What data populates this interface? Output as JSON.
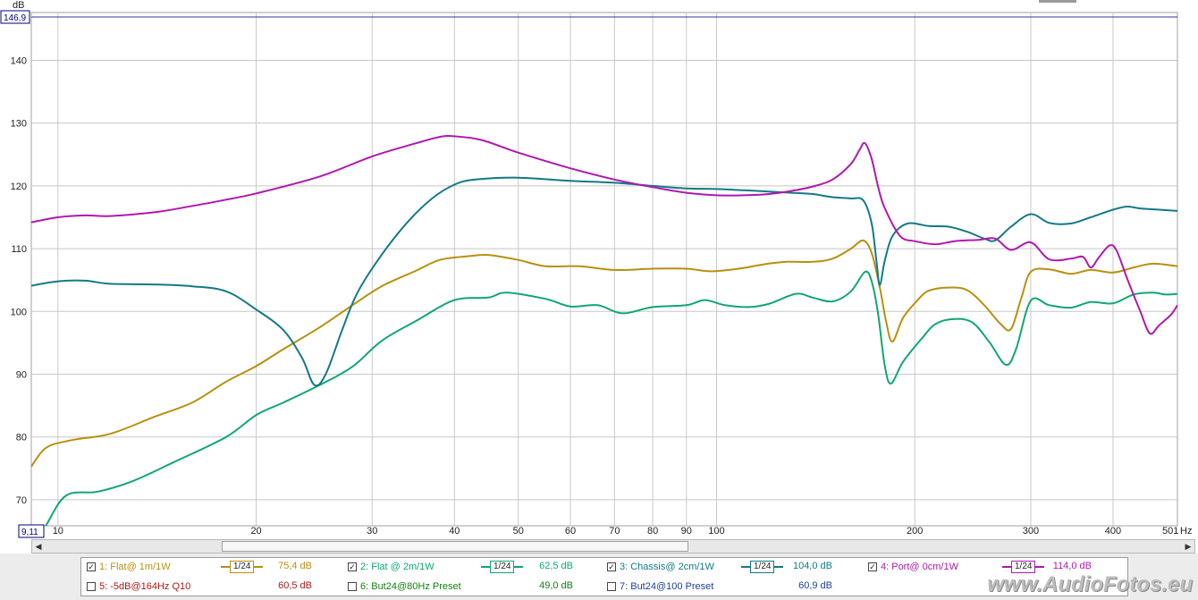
{
  "chart_data": {
    "type": "line",
    "x_scale": "log",
    "xlim": [
      9.11,
      501
    ],
    "ylim": [
      66,
      146.9
    ],
    "y_unit": "dB",
    "x_unit": "Hz",
    "y_top_label": "146,9",
    "x_left_label": "9,11",
    "x_right_label": "501",
    "yticks": [
      70,
      80,
      90,
      100,
      110,
      120,
      130,
      140
    ],
    "xticks": [
      {
        "v": 10,
        "label": "10"
      },
      {
        "v": 20,
        "label": "20"
      },
      {
        "v": 30,
        "label": "30"
      },
      {
        "v": 40,
        "label": "40"
      },
      {
        "v": 50,
        "label": "50"
      },
      {
        "v": 60,
        "label": "60"
      },
      {
        "v": 70,
        "label": "70"
      },
      {
        "v": 80,
        "label": "80"
      },
      {
        "v": 90,
        "label": "90"
      },
      {
        "v": 100,
        "label": "100"
      },
      {
        "v": 200,
        "label": "200"
      },
      {
        "v": 300,
        "label": "300"
      },
      {
        "v": 400,
        "label": "400"
      }
    ],
    "grid": true,
    "series": [
      {
        "name": "1: Flat@ 1m/1W",
        "color": "#b8900e",
        "points": [
          [
            9.11,
            75.3
          ],
          [
            9.6,
            78.3
          ],
          [
            10.5,
            79.5
          ],
          [
            12,
            80.5
          ],
          [
            14,
            83.2
          ],
          [
            16,
            85.5
          ],
          [
            18,
            88.8
          ],
          [
            20,
            91.3
          ],
          [
            22,
            94
          ],
          [
            25,
            97.5
          ],
          [
            28,
            101
          ],
          [
            31,
            104
          ],
          [
            35,
            106.5
          ],
          [
            38,
            108.2
          ],
          [
            42,
            108.8
          ],
          [
            45,
            109
          ],
          [
            50,
            108.2
          ],
          [
            55,
            107.2
          ],
          [
            62,
            107.2
          ],
          [
            70,
            106.6
          ],
          [
            80,
            106.8
          ],
          [
            90,
            106.8
          ],
          [
            98,
            106.4
          ],
          [
            108,
            106.8
          ],
          [
            118,
            107.5
          ],
          [
            128,
            107.9
          ],
          [
            140,
            107.9
          ],
          [
            150,
            108.4
          ],
          [
            160,
            110
          ],
          [
            167,
            111.3
          ],
          [
            172,
            109.3
          ],
          [
            177,
            103.8
          ],
          [
            181,
            98.3
          ],
          [
            185,
            95.2
          ],
          [
            192,
            99
          ],
          [
            202,
            101.8
          ],
          [
            210,
            103.3
          ],
          [
            225,
            103.8
          ],
          [
            240,
            103.4
          ],
          [
            255,
            101
          ],
          [
            270,
            98
          ],
          [
            280,
            97.2
          ],
          [
            290,
            102
          ],
          [
            300,
            106.3
          ],
          [
            320,
            106.7
          ],
          [
            345,
            106
          ],
          [
            370,
            106.6
          ],
          [
            400,
            106.2
          ],
          [
            430,
            107
          ],
          [
            460,
            107.6
          ],
          [
            501,
            107.2
          ]
        ]
      },
      {
        "name": "2: Flat @ 2m/1W",
        "color": "#10a870",
        "points": [
          [
            9.11,
            62
          ],
          [
            9.6,
            66
          ],
          [
            10.3,
            70.7
          ],
          [
            11.5,
            71.3
          ],
          [
            13,
            73
          ],
          [
            15,
            76
          ],
          [
            18,
            80
          ],
          [
            20,
            83.5
          ],
          [
            22,
            85.5
          ],
          [
            25,
            88.3
          ],
          [
            28,
            91.2
          ],
          [
            31,
            95.3
          ],
          [
            35,
            98.5
          ],
          [
            40,
            101.8
          ],
          [
            45,
            102.2
          ],
          [
            48,
            103
          ],
          [
            55,
            102
          ],
          [
            60,
            100.8
          ],
          [
            66,
            101
          ],
          [
            72,
            99.7
          ],
          [
            80,
            100.7
          ],
          [
            90,
            101
          ],
          [
            96,
            101.8
          ],
          [
            103,
            101
          ],
          [
            112,
            100.7
          ],
          [
            120,
            101.2
          ],
          [
            132,
            102.8
          ],
          [
            140,
            102.2
          ],
          [
            150,
            101.6
          ],
          [
            160,
            103.2
          ],
          [
            168,
            106.3
          ],
          [
            172,
            104.8
          ],
          [
            176,
            99.5
          ],
          [
            180,
            91.5
          ],
          [
            184,
            88.5
          ],
          [
            192,
            92
          ],
          [
            205,
            95.7
          ],
          [
            215,
            98
          ],
          [
            230,
            98.8
          ],
          [
            245,
            98.2
          ],
          [
            260,
            95
          ],
          [
            275,
            91.5
          ],
          [
            285,
            94
          ],
          [
            300,
            101.7
          ],
          [
            320,
            101
          ],
          [
            345,
            100.6
          ],
          [
            370,
            101.5
          ],
          [
            400,
            101.3
          ],
          [
            430,
            102.7
          ],
          [
            460,
            103
          ],
          [
            480,
            102.7
          ],
          [
            501,
            102.8
          ]
        ]
      },
      {
        "name": "3: Chassis@ 2cm/1W",
        "color": "#127a86",
        "points": [
          [
            9.11,
            104.1
          ],
          [
            10,
            104.8
          ],
          [
            11,
            104.9
          ],
          [
            12,
            104.4
          ],
          [
            14,
            104.3
          ],
          [
            16,
            104
          ],
          [
            18,
            103.2
          ],
          [
            20,
            100.3
          ],
          [
            22,
            97
          ],
          [
            23.5,
            92.5
          ],
          [
            24.5,
            88.3
          ],
          [
            25.5,
            90
          ],
          [
            27,
            97
          ],
          [
            28.5,
            103
          ],
          [
            31,
            109
          ],
          [
            34,
            114.3
          ],
          [
            37,
            118
          ],
          [
            40,
            120.2
          ],
          [
            43,
            121
          ],
          [
            50,
            121.3
          ],
          [
            60,
            120.8
          ],
          [
            70,
            120.5
          ],
          [
            80,
            120
          ],
          [
            90,
            119.6
          ],
          [
            100,
            119.5
          ],
          [
            110,
            119.3
          ],
          [
            120,
            119.1
          ],
          [
            130,
            118.9
          ],
          [
            140,
            118.7
          ],
          [
            150,
            118.2
          ],
          [
            160,
            118
          ],
          [
            167,
            117.7
          ],
          [
            172,
            114
          ],
          [
            175,
            107.8
          ],
          [
            177,
            104.2
          ],
          [
            180,
            108
          ],
          [
            185,
            112
          ],
          [
            195,
            114
          ],
          [
            210,
            113.6
          ],
          [
            225,
            113.5
          ],
          [
            240,
            112.7
          ],
          [
            255,
            111.6
          ],
          [
            265,
            111.3
          ],
          [
            280,
            113.5
          ],
          [
            300,
            115.5
          ],
          [
            320,
            114.1
          ],
          [
            345,
            114
          ],
          [
            370,
            115
          ],
          [
            400,
            116.2
          ],
          [
            420,
            116.7
          ],
          [
            440,
            116.4
          ],
          [
            470,
            116.2
          ],
          [
            501,
            116
          ]
        ]
      },
      {
        "name": "4: Port@ 0cm/1W",
        "color": "#b018b0",
        "points": [
          [
            9.11,
            114.2
          ],
          [
            10,
            115
          ],
          [
            11,
            115.3
          ],
          [
            12,
            115.2
          ],
          [
            14,
            115.8
          ],
          [
            16,
            116.8
          ],
          [
            18,
            117.8
          ],
          [
            20,
            118.8
          ],
          [
            25,
            121.5
          ],
          [
            30,
            124.7
          ],
          [
            35,
            126.8
          ],
          [
            38,
            127.8
          ],
          [
            40,
            127.9
          ],
          [
            44,
            127.3
          ],
          [
            50,
            125.3
          ],
          [
            60,
            122.8
          ],
          [
            70,
            121
          ],
          [
            80,
            119.8
          ],
          [
            90,
            118.9
          ],
          [
            100,
            118.5
          ],
          [
            110,
            118.5
          ],
          [
            120,
            118.7
          ],
          [
            130,
            119.2
          ],
          [
            140,
            119.9
          ],
          [
            150,
            121
          ],
          [
            160,
            123.5
          ],
          [
            165,
            125.8
          ],
          [
            168,
            126.8
          ],
          [
            172,
            124.3
          ],
          [
            176,
            119.8
          ],
          [
            180,
            116.5
          ],
          [
            190,
            112
          ],
          [
            200,
            111.2
          ],
          [
            215,
            110.7
          ],
          [
            230,
            111.2
          ],
          [
            250,
            111.4
          ],
          [
            265,
            111.6
          ],
          [
            280,
            109.8
          ],
          [
            300,
            111
          ],
          [
            320,
            108.3
          ],
          [
            345,
            108.4
          ],
          [
            360,
            108.7
          ],
          [
            370,
            107
          ],
          [
            380,
            108.5
          ],
          [
            395,
            110.5
          ],
          [
            405,
            109.7
          ],
          [
            420,
            105.3
          ],
          [
            440,
            100
          ],
          [
            455,
            96.5
          ],
          [
            470,
            97.8
          ],
          [
            490,
            99.5
          ],
          [
            501,
            101
          ]
        ]
      }
    ]
  },
  "legend": {
    "items": [
      {
        "label": "1: Flat@ 1m/1W",
        "checked": true,
        "smoothing": "1/24",
        "value": "75,4 dB",
        "color": "#b8900e"
      },
      {
        "label": "2: Flat @ 2m/1W",
        "checked": true,
        "smoothing": "1/24",
        "value": "62,5 dB",
        "color": "#10a870"
      },
      {
        "label": "3: Chassis@ 2cm/1W",
        "checked": true,
        "smoothing": "1/24",
        "value": "104,0 dB",
        "color": "#127a86"
      },
      {
        "label": "4: Port@ 0cm/1W",
        "checked": true,
        "smoothing": "1/24",
        "value": "114,0 dB",
        "color": "#b018b0"
      },
      {
        "label": "5: -5dB@164Hz Q10",
        "checked": false,
        "value": "60,5 dB",
        "color": "#b01818"
      },
      {
        "label": "6: But24@80Hz Preset",
        "checked": false,
        "value": "49,0 dB",
        "color": "#108010"
      },
      {
        "label": "7: But24@100 Preset",
        "checked": false,
        "value": "60,9 dB",
        "color": "#2040a0"
      }
    ]
  },
  "scrollbar": {
    "left_arrow": "◀",
    "right_arrow": "▶"
  },
  "watermark": "www.AudioFotos.eu"
}
